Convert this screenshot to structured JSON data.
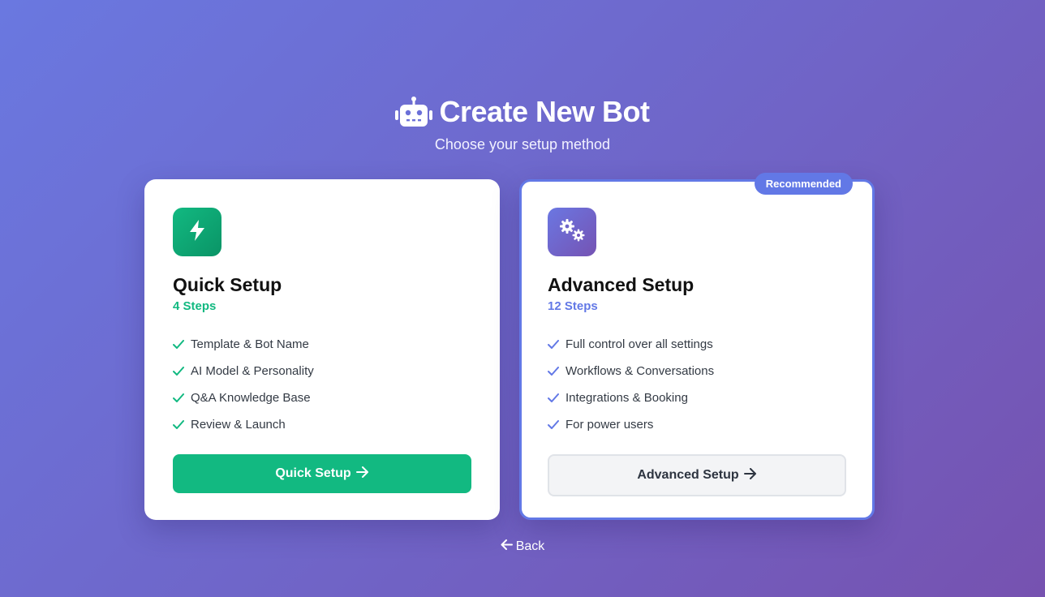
{
  "header": {
    "icon": "robot-icon",
    "title": "Create New Bot",
    "subtitle": "Choose your setup method"
  },
  "cards": [
    {
      "icon": "lightning-icon",
      "title": "Quick Setup",
      "steps": "4 Steps",
      "accent": "#12b981",
      "features": [
        "Template & Bot Name",
        "AI Model & Personality",
        "Q&A Knowledge Base",
        "Review & Launch"
      ],
      "button_label": "Quick Setup",
      "button_icon": "arrow-right-icon"
    },
    {
      "icon": "gears-icon",
      "title": "Advanced Setup",
      "steps": "12 Steps",
      "accent": "#6278e6",
      "badge": "Recommended",
      "features": [
        "Full control over all settings",
        "Workflows & Conversations",
        "Integrations & Booking",
        "For power users"
      ],
      "button_label": "Advanced Setup",
      "button_icon": "arrow-right-icon"
    }
  ],
  "back": {
    "label": "Back",
    "icon": "arrow-left-icon"
  }
}
